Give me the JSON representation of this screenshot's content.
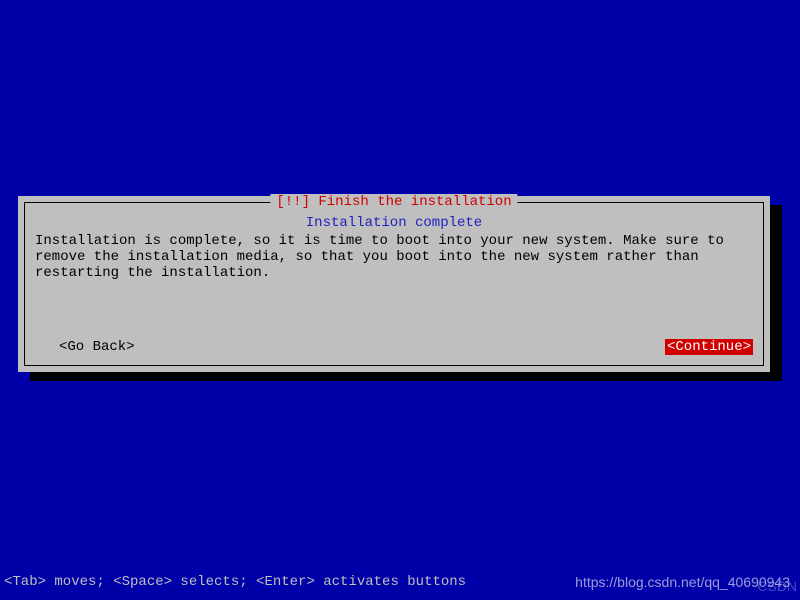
{
  "dialog": {
    "title": "[!!] Finish the installation",
    "subtitle": "Installation complete",
    "body": "Installation is complete, so it is time to boot into your new system. Make sure to remove the installation media, so that you boot into the new system rather than restarting the installation.",
    "buttons": {
      "back": "<Go Back>",
      "continue": "<Continue>"
    }
  },
  "statusbar": "<Tab> moves; <Space> selects; <Enter> activates buttons",
  "watermark": "https://blog.csdn.net/qq_40690943",
  "corner": "CSDN"
}
